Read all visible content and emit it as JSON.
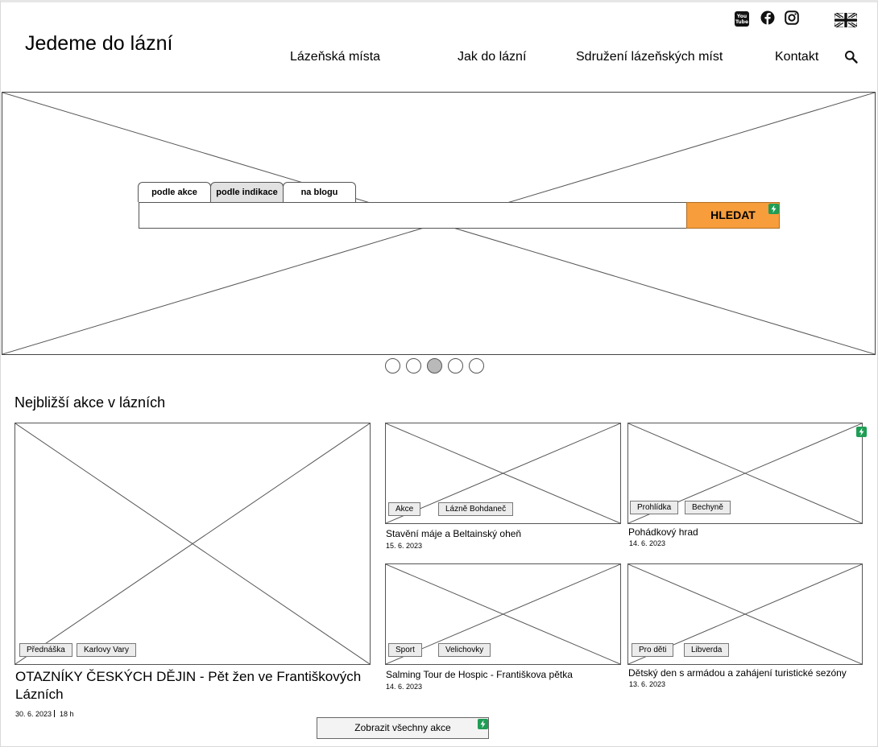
{
  "site": {
    "title": "Jedeme do lázní"
  },
  "nav": {
    "items": [
      {
        "label": "Lázeňská místa"
      },
      {
        "label": "Jak do lázní"
      },
      {
        "label": "Sdružení lázeňských míst"
      },
      {
        "label": "Kontakt"
      }
    ]
  },
  "search": {
    "tabs": [
      {
        "label": "podle akce"
      },
      {
        "label": "podle indikace"
      },
      {
        "label": "na blogu"
      }
    ],
    "active_tab": "podle indikace",
    "value": "",
    "button_label": "HLEDAT"
  },
  "carousel": {
    "slide_count": 5,
    "active_index": 3
  },
  "events": {
    "section_title": "Nejbližší akce v lázních",
    "featured": {
      "tags": [
        "Přednáška",
        "Karlovy Vary"
      ],
      "title": "OTAZNÍKY ČESKÝCH DĚJIN - Pět žen ve Františkových Lázních",
      "date": "30. 6. 2023",
      "time": "18 h"
    },
    "cards": [
      {
        "tags": [
          "Akce",
          "Lázně Bohdaneč"
        ],
        "title": "Stavění máje a Beltainský oheň",
        "date": "15. 6. 2023"
      },
      {
        "tags": [
          "Prohlídka",
          "Bechyně"
        ],
        "title": "Pohádkový hrad",
        "date": "14. 6. 2023"
      },
      {
        "tags": [
          "Sport",
          "Velichovky"
        ],
        "title": "Salming Tour de Hospic - Františkova pětka",
        "date": "14. 6. 2023"
      },
      {
        "tags": [
          "Pro děti",
          "Libverda"
        ],
        "title": "Dětský den s armádou a zahájení turistické sezóny",
        "date": "13. 6. 2023"
      }
    ],
    "show_all_label": "Zobrazit všechny akce"
  },
  "colors": {
    "accent": "#f79d3c",
    "indicator": "#1f9d55"
  }
}
